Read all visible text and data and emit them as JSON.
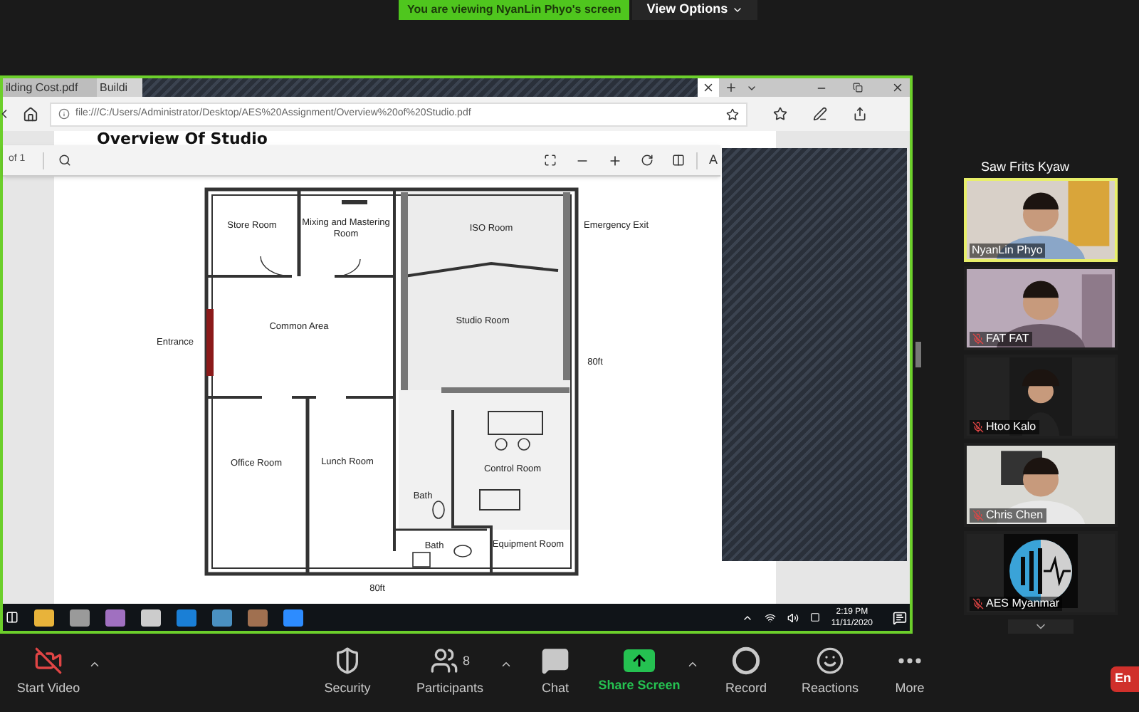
{
  "banner": {
    "text": "You are viewing NyanLin Phyo's screen"
  },
  "view_options": {
    "label": "View Options"
  },
  "browser": {
    "tabs": [
      {
        "label": "ilding Cost.pdf"
      },
      {
        "label": "Buildi"
      }
    ],
    "url": "file:///C:/Users/Administrator/Desktop/AES%20Assignment/Overview%20of%20Studio.pdf"
  },
  "pdf": {
    "title": "Overview Of Studio",
    "page_count": "of 1",
    "cut_label": "A"
  },
  "floor_plan": {
    "labels": [
      {
        "text": "Store Room"
      },
      {
        "text": "Mixing and Mastering"
      },
      {
        "text": "Room"
      },
      {
        "text": "ISO Room"
      },
      {
        "text": "Emergency Exit"
      },
      {
        "text": "Entrance"
      },
      {
        "text": "Common Area"
      },
      {
        "text": "Studio Room"
      },
      {
        "text": "80ft"
      },
      {
        "text": "Office Room"
      },
      {
        "text": "Lunch Room"
      },
      {
        "text": "Control Room"
      },
      {
        "text": "Bath"
      },
      {
        "text": "Bath"
      },
      {
        "text": "Equipment Room"
      },
      {
        "text": "80ft"
      }
    ]
  },
  "taskbar": {
    "time": "2:19 PM",
    "date": "11/11/2020"
  },
  "gallery": {
    "top_name": "Saw Frits Kyaw",
    "tiles": [
      {
        "name": "NyanLin Phyo",
        "kind": "video",
        "muted": false,
        "selected": true
      },
      {
        "name": "FAT FAT",
        "kind": "video",
        "muted": true,
        "selected": false
      },
      {
        "name": "Htoo Kalo",
        "kind": "narrow_video",
        "muted": true,
        "selected": false
      },
      {
        "name": "Chris Chen",
        "kind": "video",
        "muted": true,
        "selected": false
      },
      {
        "name": "AES Myanmar",
        "kind": "logo",
        "muted": true,
        "selected": false
      }
    ]
  },
  "toolbar": {
    "items": [
      {
        "label": "Start Video",
        "kind": "video",
        "on": false,
        "menu": true
      },
      {
        "label": "Security",
        "kind": "security",
        "menu": false
      },
      {
        "label": "Participants",
        "kind": "participants",
        "count": "8",
        "menu": true
      },
      {
        "label": "Chat",
        "kind": "chat",
        "menu": false
      },
      {
        "label": "Share Screen",
        "kind": "share",
        "menu": true
      },
      {
        "label": "Record",
        "kind": "record",
        "menu": false
      },
      {
        "label": "Reactions",
        "kind": "reactions",
        "menu": false
      },
      {
        "label": "More",
        "kind": "more",
        "menu": false
      }
    ],
    "end_label": "En"
  }
}
